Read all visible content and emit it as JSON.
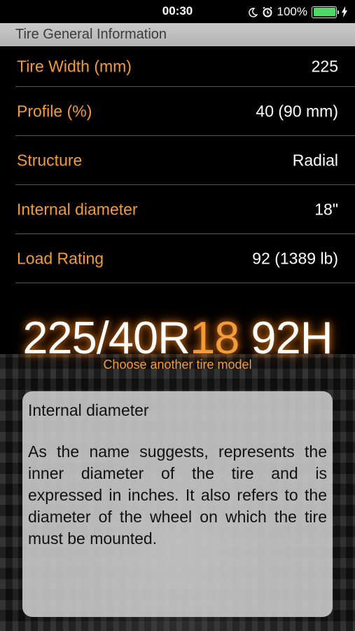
{
  "status_bar": {
    "time": "00:30",
    "battery": "100%",
    "battery_level": 1.0,
    "icons": [
      "moon-icon",
      "alarm-icon",
      "battery-icon",
      "charging-bolt-icon"
    ]
  },
  "section_header": "Tire General Information",
  "rows": [
    {
      "label": "Tire Width (mm)",
      "value": "225"
    },
    {
      "label": "Profile (%)",
      "value": "40 (90 mm)"
    },
    {
      "label": "Structure",
      "value": "Radial"
    },
    {
      "label": "Internal diameter",
      "value": "18\""
    },
    {
      "label": "Load Rating",
      "value": "92 (1389 lb)"
    }
  ],
  "tire_code": {
    "prefix": "225/40R",
    "highlight": "18",
    "suffix": " 92H"
  },
  "choose_link": "Choose another tire model",
  "info_card": {
    "title": "Internal diameter",
    "body": "As the name suggests, represents the inner diameter of the tire and is expressed in inches. It also refers to the diameter of the wheel on which the tire must be mounted."
  },
  "colors": {
    "accent": "#f39a3a",
    "battery": "#4cd964",
    "header_bg": "#c0c0c0"
  }
}
